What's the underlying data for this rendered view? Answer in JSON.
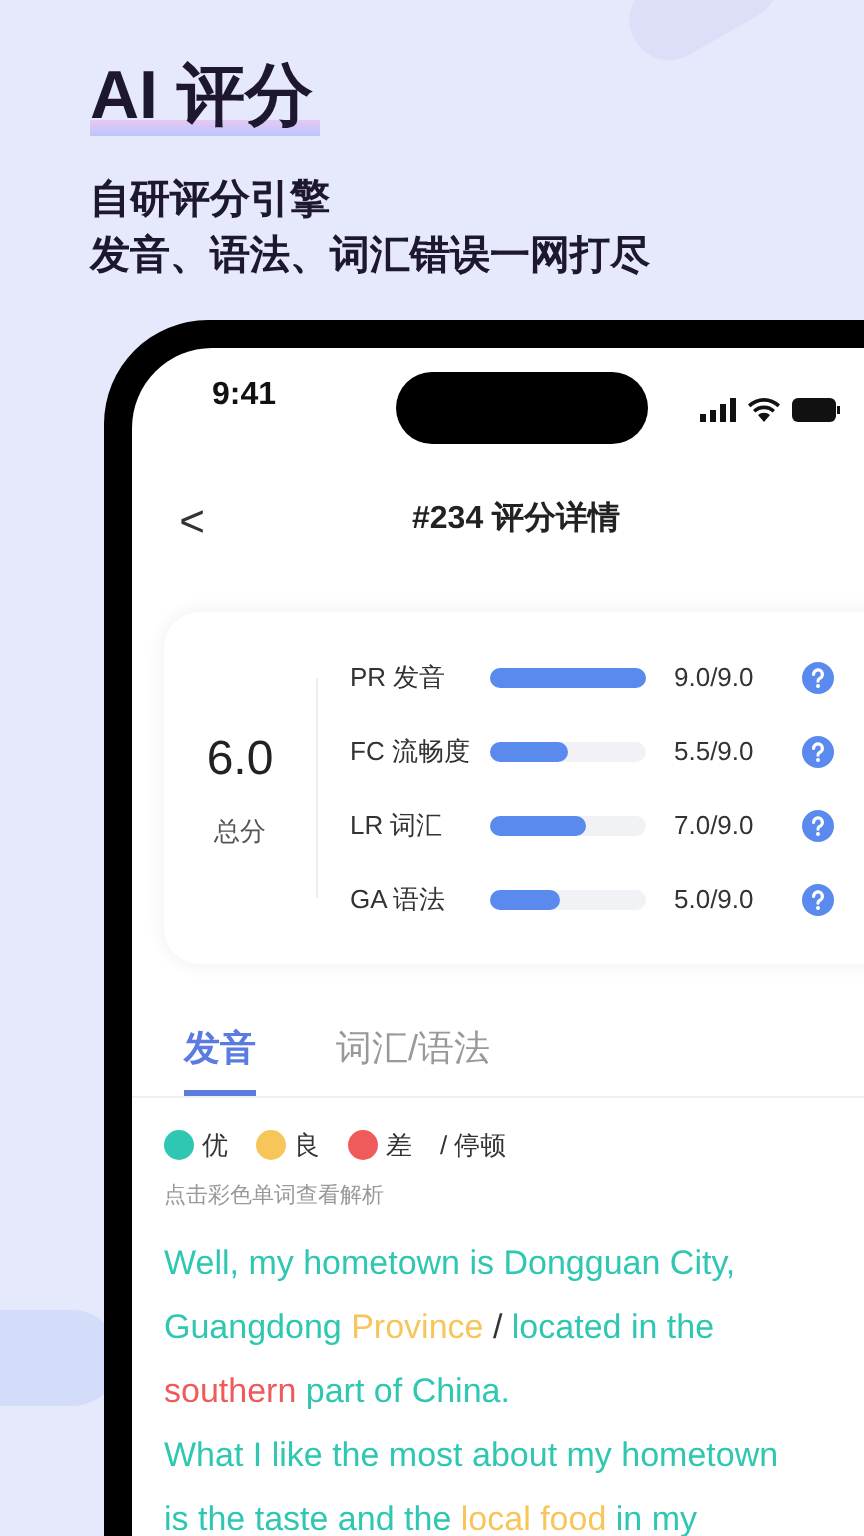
{
  "headline": "AI 评分",
  "subtitle_lines": [
    "自研评分引擎",
    "发音、语法、词汇错误一网打尽"
  ],
  "status_bar": {
    "time": "9:41"
  },
  "nav": {
    "back": "<",
    "title": "#234 评分详情"
  },
  "overall": {
    "score": "6.0",
    "label": "总分"
  },
  "scores": [
    {
      "label": "PR 发音",
      "level": 1.0,
      "reading": "9.0/9.0"
    },
    {
      "label": "FC 流畅度",
      "level": 0.5,
      "reading": "5.5/9.0"
    },
    {
      "label": "LR 词汇",
      "level": 0.62,
      "reading": "7.0/9.0"
    },
    {
      "label": "GA 语法",
      "level": 0.45,
      "reading": "5.0/9.0"
    }
  ],
  "tabs": [
    {
      "label": "发音",
      "selected": true
    },
    {
      "label": "词汇/语法",
      "selected": false
    }
  ],
  "legend": [
    {
      "label": "优",
      "color": "#2fc7b1"
    },
    {
      "label": "良",
      "color": "#f6c65b"
    },
    {
      "label": "差",
      "color": "#ef5b5b"
    }
  ],
  "pause_label": "/ 停顿",
  "hint": "点击彩色单词查看解析",
  "transcript_lines": [
    [
      {
        "text": "Well, my hometown is Dongguan City,",
        "color": "#2fc7b1"
      }
    ],
    [
      {
        "text": "Guangdong ",
        "color": "#2fc7b1"
      },
      {
        "text": "Province",
        "color": "#f6c65b"
      },
      {
        "text": " / ",
        "color": "#333333"
      },
      {
        "text": "located in the",
        "color": "#2fc7b1"
      }
    ],
    [
      {
        "text": "southern",
        "color": "#ef5b5b"
      },
      {
        "text": " part of China.",
        "color": "#2fc7b1"
      }
    ],
    [
      {
        "text": "What I like the most about my hometown",
        "color": "#2fc7b1"
      }
    ],
    [
      {
        "text": "is the taste and the ",
        "color": "#2fc7b1"
      },
      {
        "text": "local food",
        "color": "#f6c65b"
      },
      {
        "text": " in my",
        "color": "#2fc7b1"
      }
    ]
  ]
}
